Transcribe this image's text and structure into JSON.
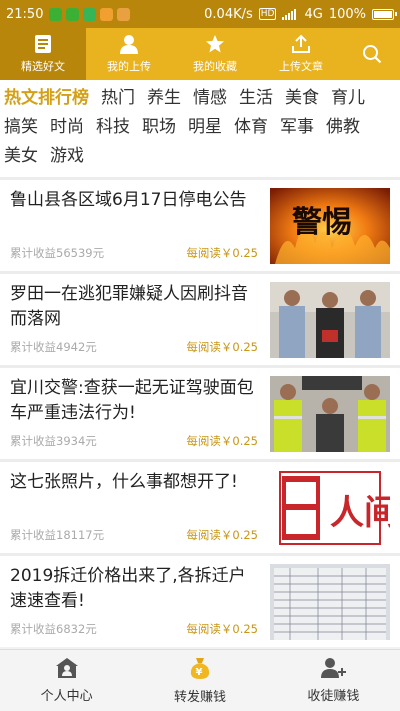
{
  "status_bar": {
    "time": "21:50",
    "network_speed": "0.04K/s",
    "hd_badge": "HD",
    "signal": "4G",
    "battery": "100%"
  },
  "top_nav": {
    "tabs": [
      {
        "label": "精选好文",
        "icon": "article-icon",
        "active": true
      },
      {
        "label": "我的上传",
        "icon": "user-icon",
        "active": false
      },
      {
        "label": "我的收藏",
        "icon": "star-icon",
        "active": false
      },
      {
        "label": "上传文章",
        "icon": "upload-icon",
        "active": false
      }
    ],
    "search_icon": "search-icon"
  },
  "categories": [
    "热文排行榜",
    "热门",
    "养生",
    "情感",
    "生活",
    "美食",
    "育儿",
    "搞笑",
    "时尚",
    "科技",
    "职场",
    "明星",
    "体育",
    "军事",
    "佛教",
    "美女",
    "游戏"
  ],
  "news": [
    {
      "title": "鲁山县各区域6月17日停电公告",
      "earnings": "累计收益56539元",
      "rate": "每阅读￥0.25",
      "thumb_text": "警惕"
    },
    {
      "title": "罗田一在逃犯罪嫌疑人因刷抖音而落网",
      "earnings": "累计收益4942元",
      "rate": "每阅读￥0.25"
    },
    {
      "title": "宜川交警:查获一起无证驾驶面包车严重违法行为!",
      "earnings": "累计收益3934元",
      "rate": "每阅读￥0.25"
    },
    {
      "title": "这七张照片，什么事都想开了!",
      "earnings": "累计收益18117元",
      "rate": "每阅读￥0.25",
      "thumb_text": "人间"
    },
    {
      "title": "2019拆迁价格出来了,各拆迁户速速查看!",
      "earnings": "累计收益6832元",
      "rate": "每阅读￥0.25"
    }
  ],
  "bottom_nav": {
    "tabs": [
      {
        "label": "个人中心",
        "icon": "home-person-icon"
      },
      {
        "label": "转发赚钱",
        "icon": "money-bag-icon"
      },
      {
        "label": "收徒赚钱",
        "icon": "add-user-icon"
      }
    ]
  },
  "colors": {
    "status_bar": "#b8860b",
    "top_nav": "#e9b21f",
    "active_tab": "#b8860b",
    "category_active": "#d4a017",
    "rate_text": "#c99616"
  }
}
